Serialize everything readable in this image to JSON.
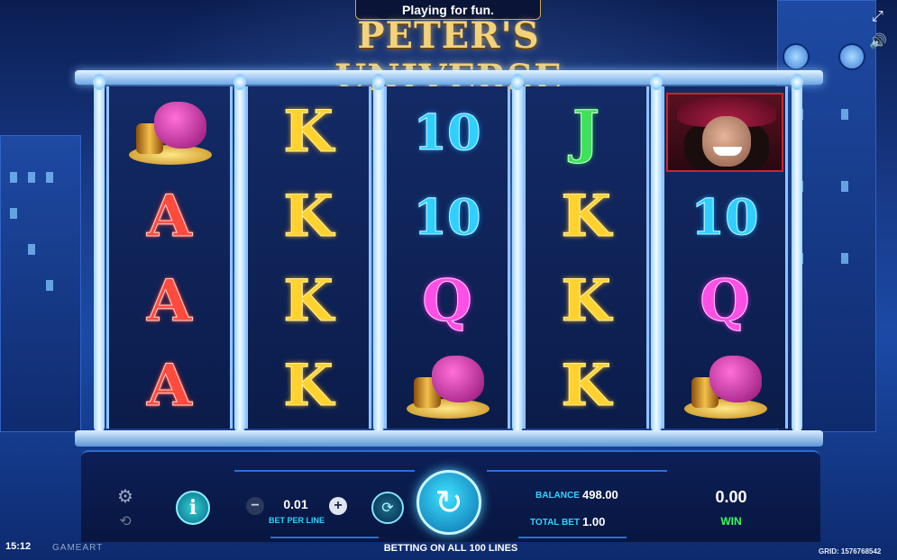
{
  "header": {
    "playing_for_fun": "Playing for fun.",
    "title": "PETER'S UNIVERSE"
  },
  "icons": {
    "fullscreen": "fullscreen-icon",
    "sound": "speaker-icon",
    "settings": "gear-icon",
    "history": "history-icon",
    "info": "info-icon",
    "autoplay": "autoplay-icon",
    "spin": "spin-arrow-icon"
  },
  "reels": [
    [
      "treasure",
      "A",
      "A",
      "A"
    ],
    [
      "K",
      "K",
      "K",
      "K"
    ],
    [
      "10",
      "10",
      "Q",
      "treasure"
    ],
    [
      "J",
      "K",
      "K",
      "K"
    ],
    [
      "captain",
      "10",
      "Q",
      "treasure"
    ]
  ],
  "controls": {
    "bet_per_line_value": "0.01",
    "bet_per_line_label": "BET PER LINE",
    "minus": "−",
    "plus": "+",
    "balance_label": "BALANCE",
    "balance_value": "498.00",
    "total_bet_label": "TOTAL BET",
    "total_bet_value": "1.00",
    "win_amount": "0.00",
    "win_label": "WIN",
    "lines_text": "BETTING ON ALL 100 LINES",
    "info_glyph": "i"
  },
  "footer": {
    "clock": "15:12",
    "brand": "GAMEART",
    "grid_id": "GRID: 1576768542"
  },
  "colors": {
    "accent_cyan": "#32d2ff",
    "win_green": "#32ff5a",
    "title_gold": "#f3d27a"
  }
}
